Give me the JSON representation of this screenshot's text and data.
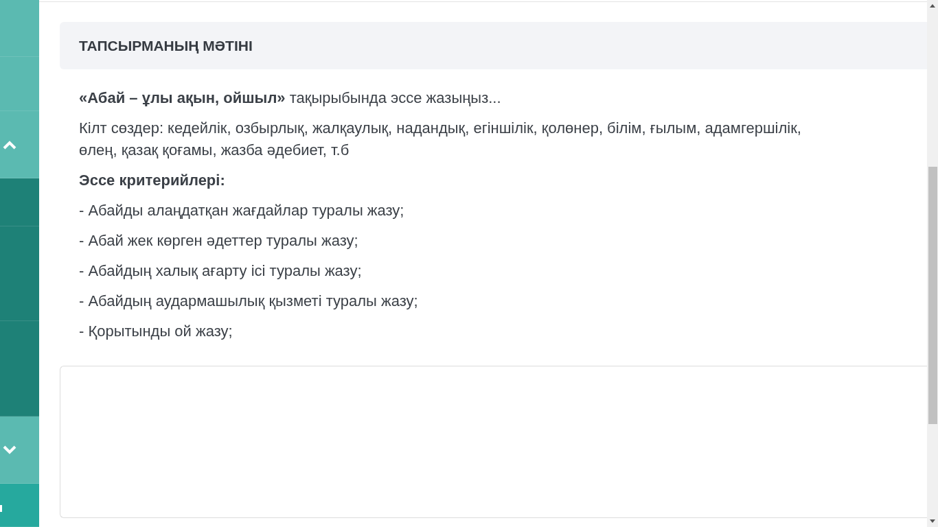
{
  "sidebar": {
    "items": [
      {
        "kind": "light"
      },
      {
        "kind": "light"
      },
      {
        "kind": "scroll-up"
      },
      {
        "kind": "dark"
      },
      {
        "kind": "dark"
      },
      {
        "kind": "dark"
      },
      {
        "kind": "scroll-down"
      },
      {
        "kind": "footer"
      }
    ]
  },
  "task": {
    "title": "ТАПСЫРМАНЫҢ МӘТІНІ",
    "paragraphs": [
      {
        "kind": "text",
        "text": "**«Абай – ұлы ақын, ойшыл»** тақырыбында эссе жазыңыз..."
      },
      {
        "kind": "text",
        "text": "Кілт сөздер: кедейлік, озбырлық, жалқаулық, надандық, егіншілік, қолөнер, білім, ғылым, адамгершілік, өлең, қазақ қоғамы, жазба әдебиет, т.б"
      },
      {
        "kind": "heading",
        "text": "Эссе критерийлері:"
      },
      {
        "kind": "text",
        "text": "- Абайды алаңдатқан жағдайлар туралы жазу;"
      },
      {
        "kind": "text",
        "text": "- Абай жек көрген әдеттер туралы жазу;"
      },
      {
        "kind": "text",
        "text": "- Абайдың халық ағарту ісі туралы жазу;"
      },
      {
        "kind": "text",
        "text": "- Абайдың аудармашылық қызметі туралы жазу;"
      },
      {
        "kind": "text",
        "text": "- Қорытынды ой жазу;"
      }
    ]
  }
}
